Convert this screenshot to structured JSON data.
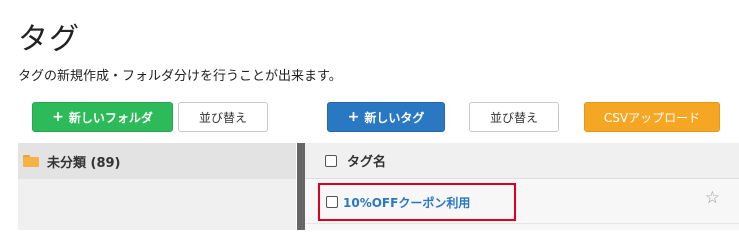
{
  "header": {
    "title": "タグ",
    "description": "タグの新規作成・フォルダ分けを行うことが出来ます。"
  },
  "toolbar": {
    "new_folder_label": "新しいフォルダ",
    "sort_folders_label": "並び替え",
    "new_tag_label": "新しいタグ",
    "sort_tags_label": "並び替え",
    "csv_upload_label": "CSVアップロード",
    "plus_symbol": "+"
  },
  "folders": {
    "items": [
      {
        "label": "未分類 (89)"
      }
    ]
  },
  "tags_table": {
    "header_label": "タグ名",
    "rows": [
      {
        "name": "10%OFFクーポン利用",
        "star": "☆"
      }
    ]
  },
  "colors": {
    "green": "#2dbb5a",
    "blue": "#2a78c2",
    "orange": "#f5a623",
    "highlight": "#e0001b"
  }
}
